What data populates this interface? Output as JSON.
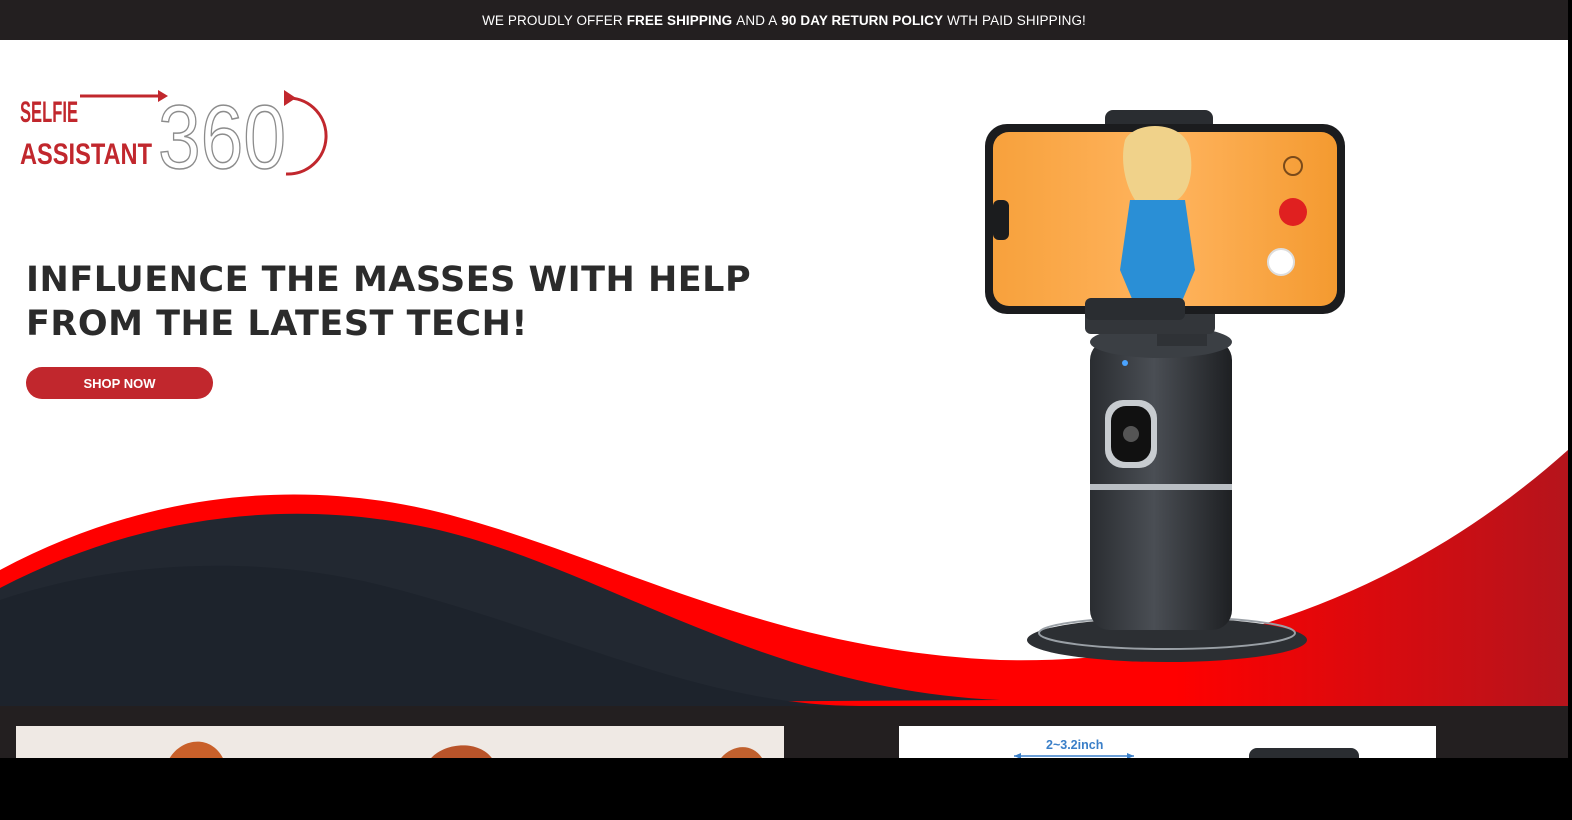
{
  "announcement": {
    "part1": "WE PROUDLY OFFER",
    "bold1": "FREE SHIPPING",
    "part2": "AND A",
    "bold2": "90 DAY RETURN POLICY",
    "part3": "WTH PAID SHIPPING!"
  },
  "logo": {
    "line1": "SELFIE",
    "line2": "ASSISTANT",
    "number": "360"
  },
  "hero": {
    "headline_line1": "INFLUENCE THE MASSES WITH HELP",
    "headline_line2": "FROM THE LATEST TECH!",
    "cta_label": "SHOP NOW"
  },
  "features": {
    "dimension_label": "2~3.2inch"
  },
  "colors": {
    "brand_red": "#c1272d",
    "wave_red": "#ff0000",
    "wave_dark": "#222831",
    "bar_dark": "#231f20"
  }
}
